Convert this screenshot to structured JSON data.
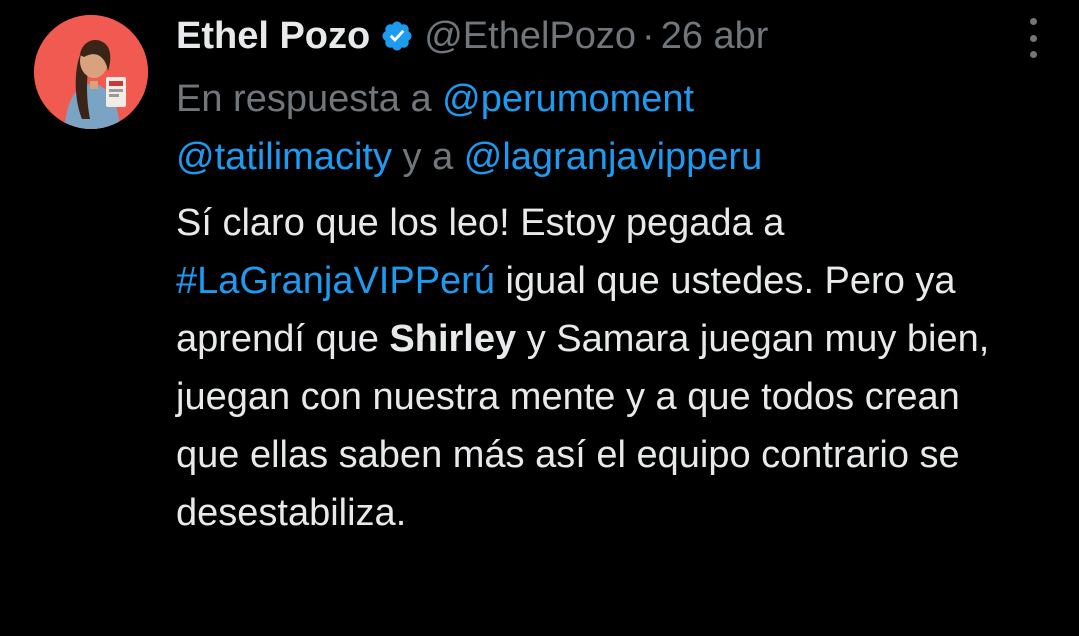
{
  "tweet": {
    "author": {
      "name": "Ethel Pozo",
      "handle": "@EthelPozo",
      "verified": true
    },
    "separator": "·",
    "date": "26 abr",
    "reply": {
      "prefix": "En respuesta a",
      "mention1": "@perumoment",
      "mention2": "@tatilimacity",
      "connector": "y a",
      "mention3": "@lagranjavipperu"
    },
    "body": {
      "p1": "Sí claro que los leo! Estoy pegada a",
      "hashtag": "#LaGranjaVIPPerú",
      "p2": "igual que ustedes. Pero ya aprendí que",
      "bold_name": "Shirley",
      "p3": "y Samara juegan muy bien, juegan con nuestra mente y a que todos crean que ellas saben más así el equipo contrario se desestabiliza."
    }
  },
  "colors": {
    "background": "#000000",
    "text": "#e7e9ea",
    "secondary": "#71767b",
    "link": "#1d9bf0",
    "avatar_bg": "#f05a50"
  },
  "icons": {
    "verified": "verified-badge-icon",
    "more": "more-options-icon"
  }
}
